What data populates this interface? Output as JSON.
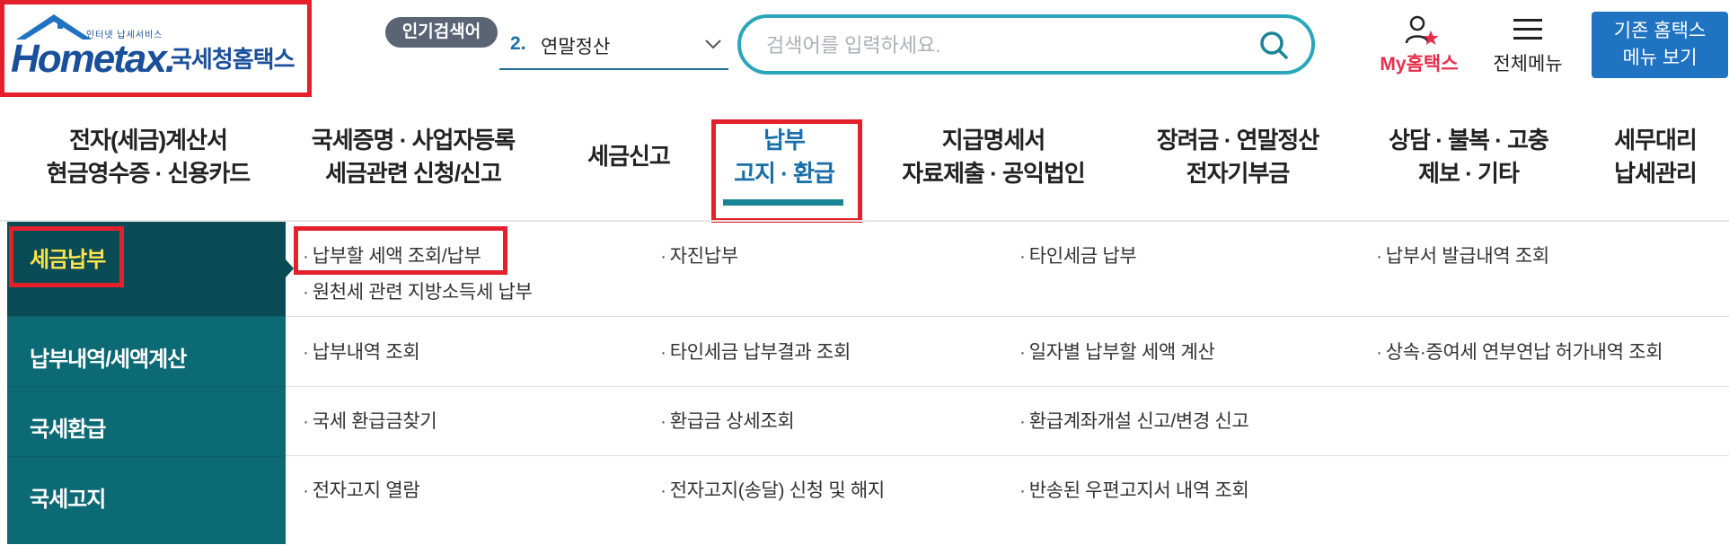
{
  "logo": {
    "tagline": "인터넷 납세서비스",
    "wordmark": "Hometax.",
    "agency": "국세청홈택스"
  },
  "popular_search": {
    "badge": "인기검색어",
    "rank": "2.",
    "keyword": "연말정산"
  },
  "search": {
    "placeholder": "검색어를 입력하세요."
  },
  "header": {
    "my_hometax": "My홈택스",
    "all_menu": "전체메뉴",
    "old_menu_line1": "기존 홈택스",
    "old_menu_line2": "메뉴 보기"
  },
  "gnb": [
    {
      "line1": "전자(세금)계산서",
      "line2": "현금영수증 · 신용카드"
    },
    {
      "line1": "국세증명 · 사업자등록",
      "line2": "세금관련 신청/신고"
    },
    {
      "line1": "세금신고",
      "line2": ""
    },
    {
      "line1": "납부",
      "line2": "고지 · 환급",
      "active": true
    },
    {
      "line1": "지급명세서",
      "line2": "자료제출 · 공익법인"
    },
    {
      "line1": "장려금 · 연말정산",
      "line2": "전자기부금"
    },
    {
      "line1": "상담 · 불복 · 고충",
      "line2": "제보 · 기타"
    },
    {
      "line1": "세무대리",
      "line2": "납세관리"
    }
  ],
  "lnb": [
    {
      "label": "세금납부",
      "active": true
    },
    {
      "label": "납부내역/세액계산"
    },
    {
      "label": "국세환급"
    },
    {
      "label": "국세고지"
    }
  ],
  "submenu": {
    "row1": [
      "납부할 세액 조회/납부",
      "자진납부",
      "타인세금 납부",
      "납부서 발급내역 조회",
      "원천세 관련 지방소득세 납부"
    ],
    "row2": [
      "납부내역 조회",
      "타인세금 납부결과 조회",
      "일자별 납부할 세액 계산",
      "상속·증여세 연부연납 허가내역 조회"
    ],
    "row3": [
      "국세 환급금찾기",
      "환급금 상세조회",
      "환급계좌개설 신고/변경 신고"
    ],
    "row4": [
      "전자고지 열람",
      "전자고지(송달) 신청 및 해지",
      "반송된 우편고지서 내역 조회"
    ]
  },
  "colors": {
    "highlight_red": "#e3202b",
    "teal_dark": "#0a4c55",
    "teal": "#0c6a75",
    "accent_blue": "#1f73c0",
    "active_yellow": "#ffe34a"
  }
}
